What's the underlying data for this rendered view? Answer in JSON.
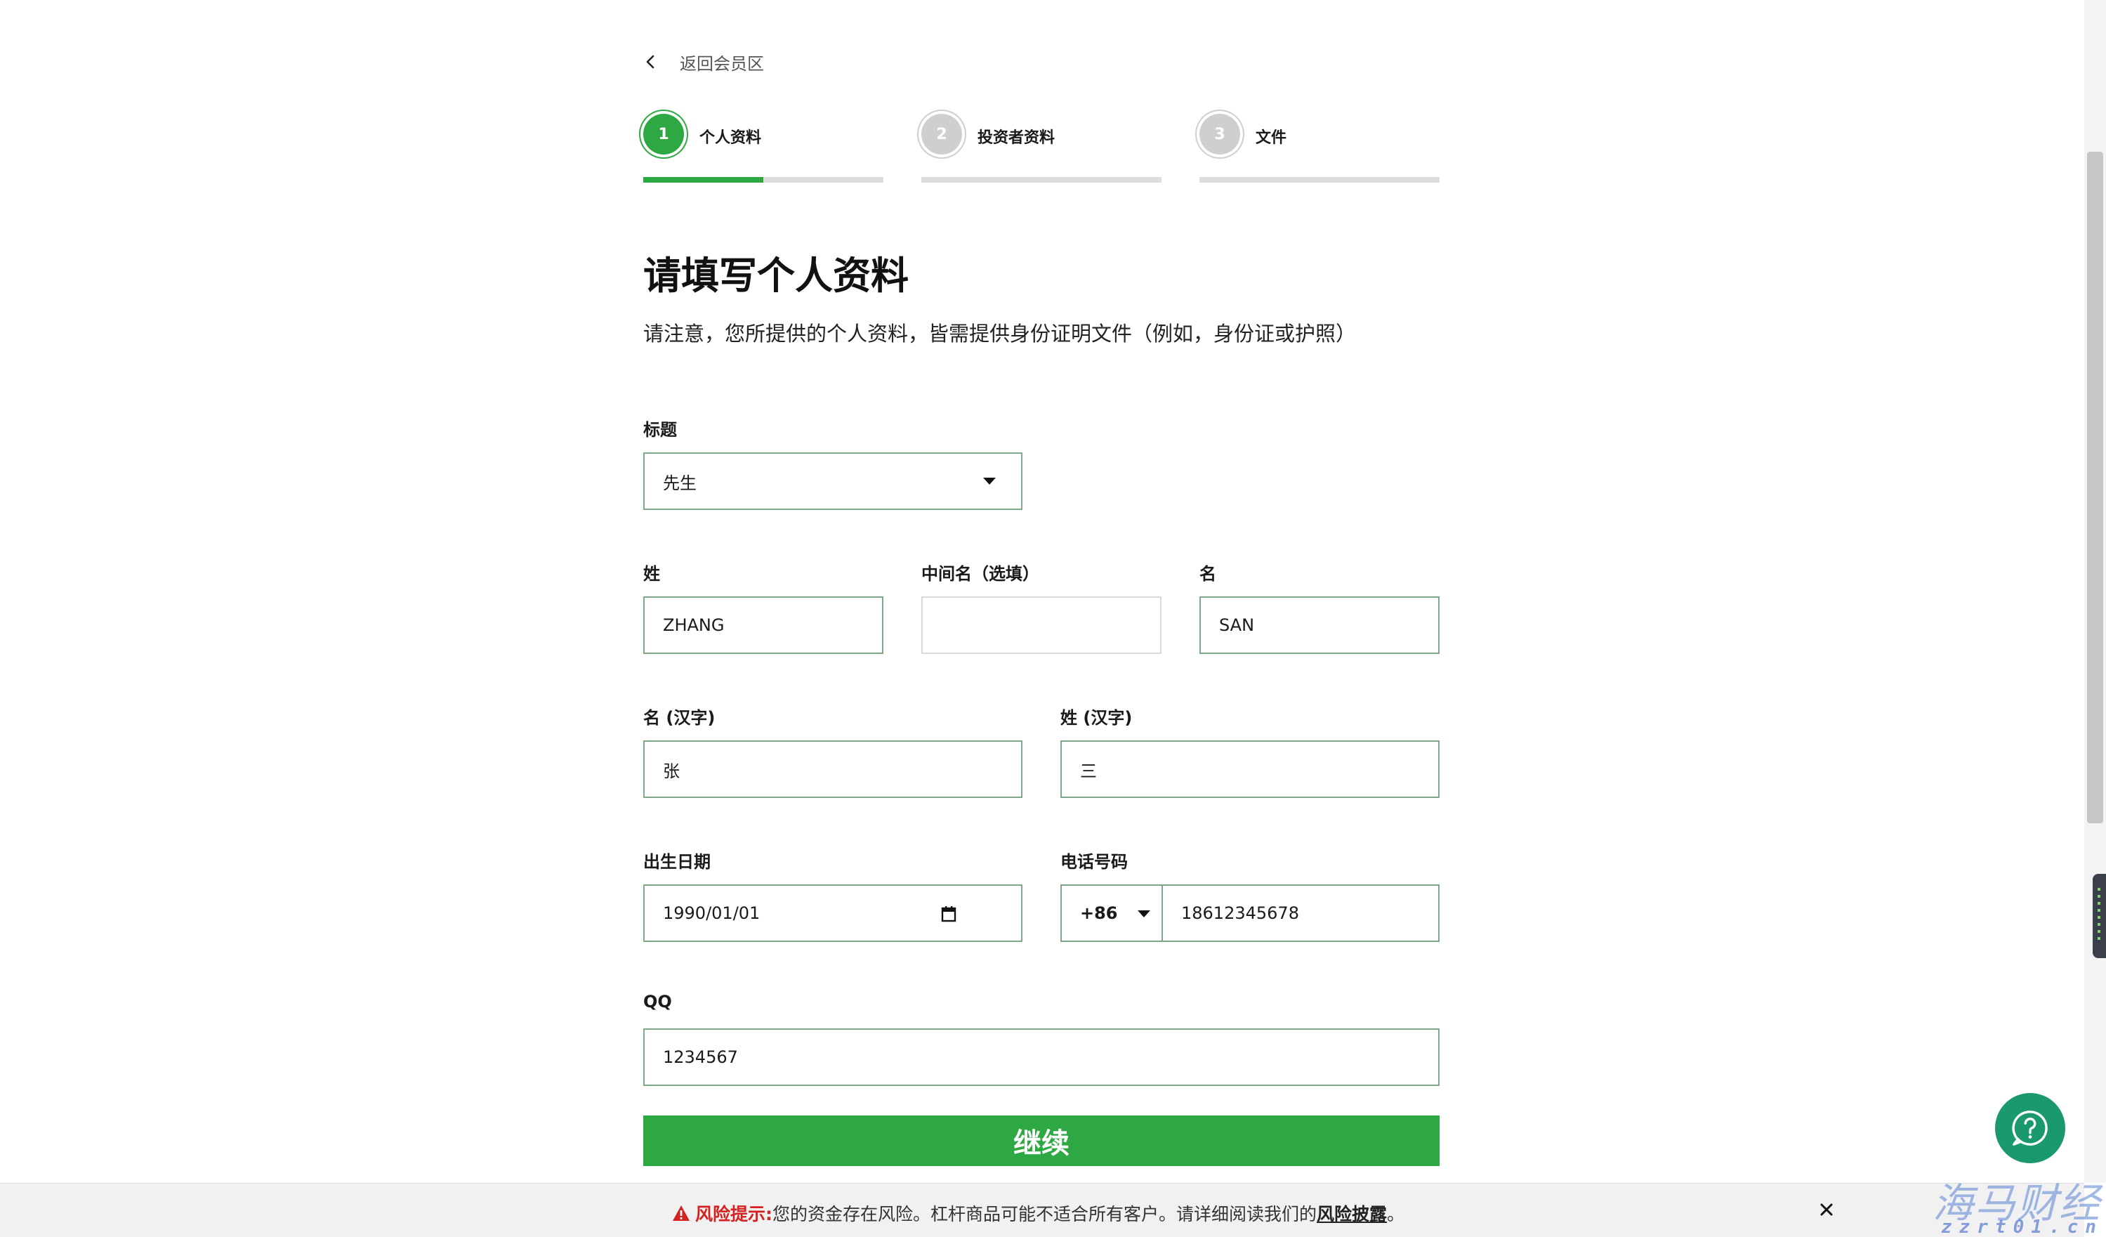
{
  "nav": {
    "back_label": "返回会员区"
  },
  "steps": [
    {
      "number": "1",
      "label": "个人资料",
      "state": "active",
      "progress": 0.5
    },
    {
      "number": "2",
      "label": "投资者资料",
      "state": "inactive",
      "progress": 0
    },
    {
      "number": "3",
      "label": "文件",
      "state": "inactive",
      "progress": 0
    }
  ],
  "form": {
    "title": "请填写个人资料",
    "subtitle": "请注意，您所提供的个人资料，皆需提供身份证明文件（例如，身份证或护照）",
    "salutation": {
      "label": "标题",
      "value": "先生"
    },
    "last_name": {
      "label": "姓",
      "value": "ZHANG"
    },
    "middle_name": {
      "label": "中间名（选填）",
      "value": ""
    },
    "first_name": {
      "label": "名",
      "value": "SAN"
    },
    "first_name_cn": {
      "label": "名 (汉字)",
      "value": "张"
    },
    "last_name_cn": {
      "label": "姓 (汉字)",
      "value": "三"
    },
    "dob": {
      "label": "出生日期",
      "value": "1990/01/01"
    },
    "phone": {
      "label": "电话号码",
      "code": "+86",
      "number": "18612345678"
    },
    "qq": {
      "label": "QQ",
      "value": "1234567"
    },
    "continue_label": "继续"
  },
  "risk": {
    "label": "风险提示:",
    "text": " 您的资金存在风险。杠杆商品可能不适合所有客户。请详细阅读我们的",
    "link": "风险披露",
    "end": "。"
  },
  "watermark": {
    "top": "海马财经",
    "bottom": "zzrt01.cn"
  },
  "colors": {
    "accent": "#2ea843",
    "help": "#1a9a6c",
    "risk": "#d42222",
    "field_border": "#7fa88b"
  }
}
